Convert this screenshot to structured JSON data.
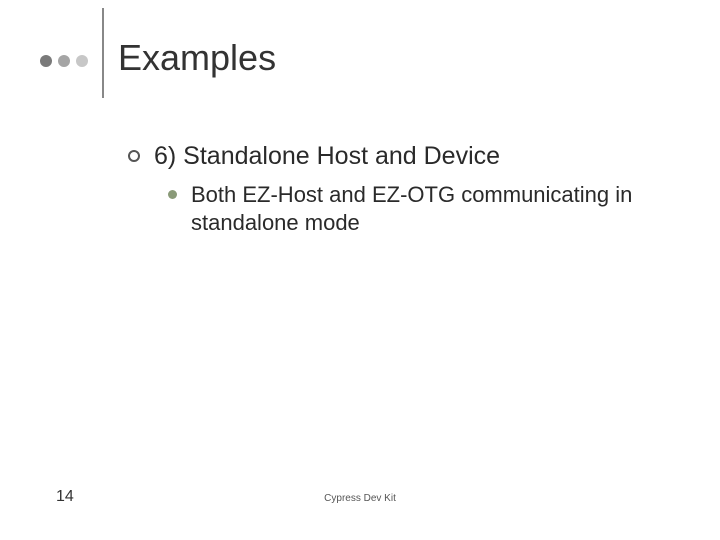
{
  "slide": {
    "title": "Examples",
    "level1": "6) Standalone Host and Device",
    "level2": "Both EZ-Host and EZ-OTG communicating in standalone mode",
    "page_number": "14",
    "footer": "Cypress Dev Kit"
  }
}
